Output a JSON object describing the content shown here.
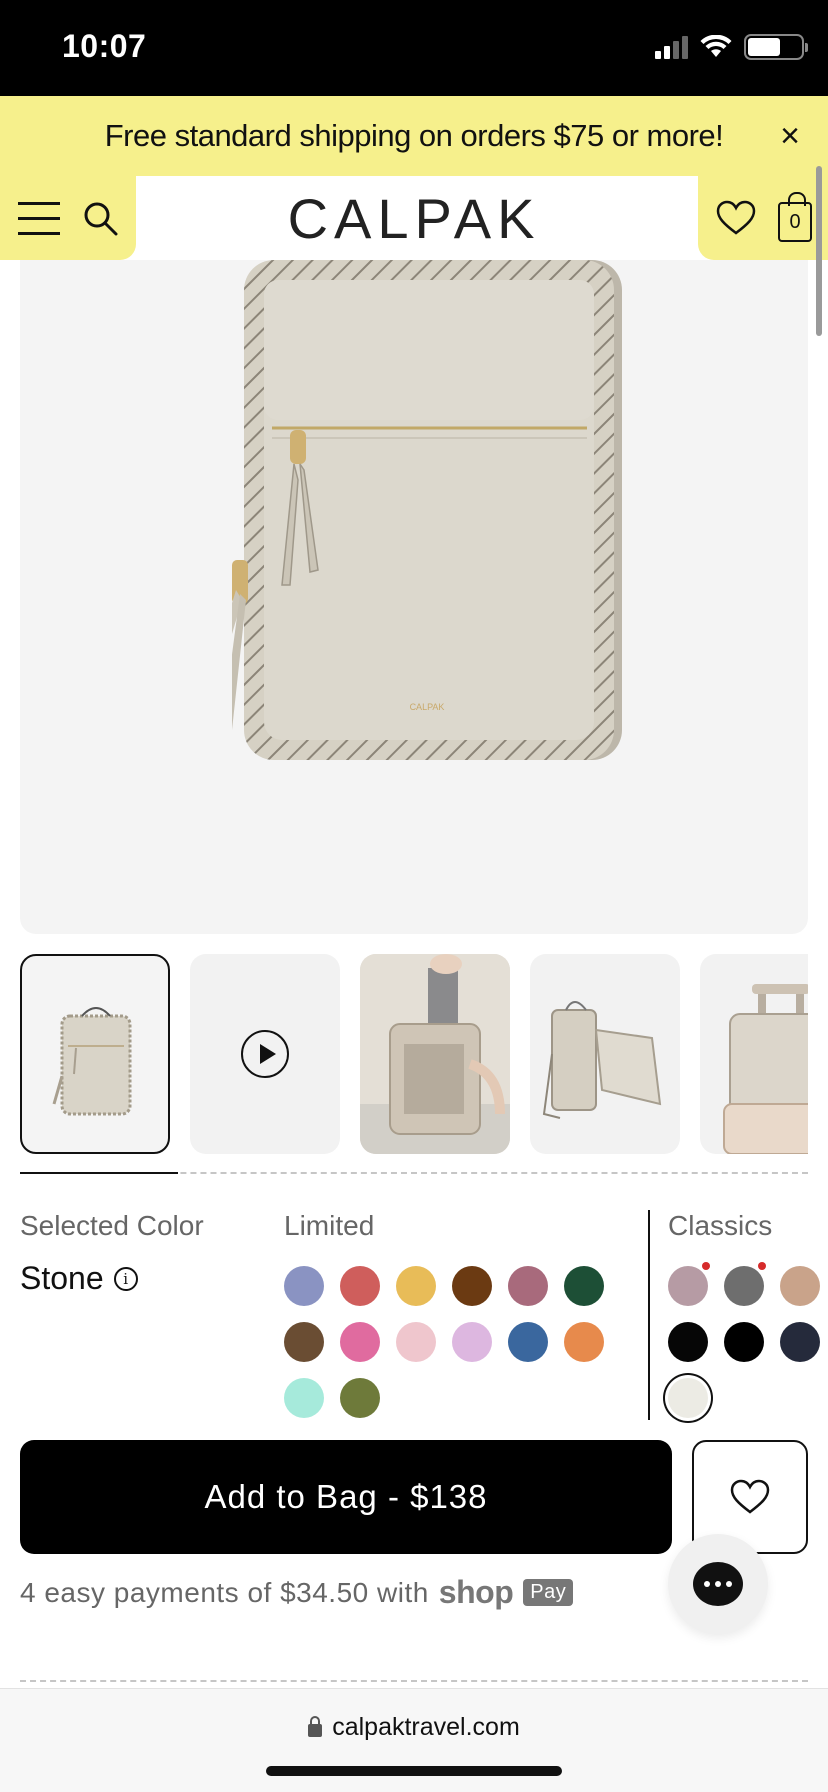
{
  "status_bar": {
    "time": "10:07"
  },
  "promo": {
    "text": "Free standard shipping on orders $75 or more!",
    "close": "×"
  },
  "header": {
    "logo": "CALPAK",
    "cart_count": "0"
  },
  "product": {
    "selected_color_label": "Selected Color",
    "selected_color_value": "Stone",
    "info_glyph": "i",
    "limited_label": "Limited",
    "classics_label": "Classics",
    "limited_swatches": [
      "#8a93c2",
      "#cf5e5c",
      "#e8bc58",
      "#6b3a12",
      "#a86a7c",
      "#1d4f36",
      "#6a4d33",
      "#e06b9f",
      "#efc6cd",
      "#ddb7e0",
      "#3a679e",
      "#e78a4c",
      "#a6eadb",
      "#6e7a3a"
    ],
    "classic_swatches": [
      {
        "color": "#b69ba4",
        "new": true
      },
      {
        "color": "#6e6e6e",
        "new": true
      },
      {
        "color": "#c9a38a",
        "new": false
      },
      {
        "color": "#060606",
        "new": false
      },
      {
        "color": "#000000",
        "new": false
      },
      {
        "color": "#252a3b",
        "new": false
      },
      {
        "color": "#ecebe4",
        "new": false,
        "selected": true
      }
    ],
    "add_to_bag_label": "Add to Bag - $138",
    "payments_text": "4 easy payments of $34.50 with",
    "shop_text": "shop",
    "pay_badge": "Pay"
  },
  "thumbnails": [
    {
      "kind": "image",
      "name": "backpack-front"
    },
    {
      "kind": "video",
      "name": "video"
    },
    {
      "kind": "image",
      "name": "backpack-open-laptop"
    },
    {
      "kind": "image",
      "name": "backpack-side"
    },
    {
      "kind": "image",
      "name": "backpack-on-luggage"
    }
  ],
  "browser": {
    "url": "calpaktravel.com"
  },
  "colors": {
    "promo_bg": "#f6f08c",
    "button_bg": "#000000",
    "hero_bg": "#f4f4f4"
  }
}
